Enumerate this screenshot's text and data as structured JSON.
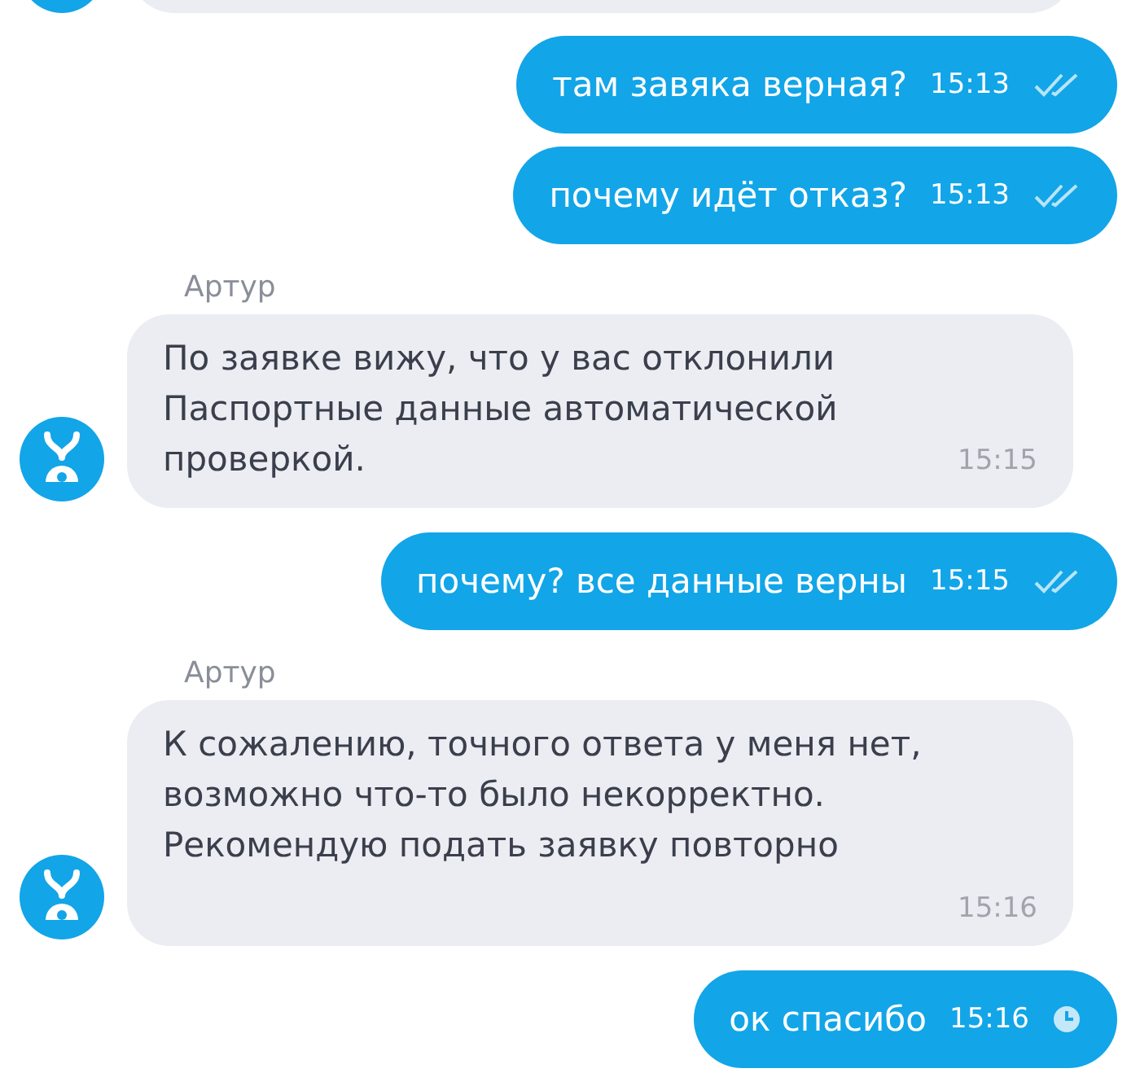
{
  "messages": [
    {
      "kind": "outgoing",
      "text": "там завяка верная?",
      "time": "15:13",
      "read": true
    },
    {
      "kind": "outgoing",
      "text": "почему идёт отказ?",
      "time": "15:13",
      "read": true
    },
    {
      "kind": "incoming",
      "sender": "Артур",
      "lines": [
        "По заявке вижу, что у вас отклонили",
        "Паспортные данные автоматической",
        "проверкой."
      ],
      "time": "15:15"
    },
    {
      "kind": "outgoing",
      "text": "почему? все данные верны",
      "time": "15:15",
      "read": true
    },
    {
      "kind": "incoming",
      "sender": "Артур",
      "lines": [
        "К сожалению, точного ответа у меня нет,",
        "возможно что-то было некорректно.",
        "Рекомендую подать заявку повторно"
      ],
      "time": "15:16"
    },
    {
      "kind": "outgoing",
      "text": "ок спасибо",
      "time": "15:16",
      "read": false
    }
  ]
}
